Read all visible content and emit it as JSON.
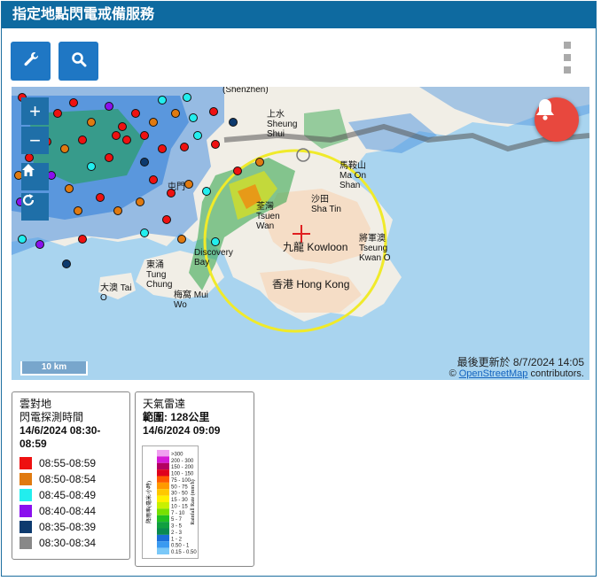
{
  "title": "指定地點閃電戒備服務",
  "toolbar": {
    "tools_icon": "wrench-icon",
    "search_icon": "search-icon",
    "menu_icon": "kebab-menu-icon"
  },
  "map": {
    "zoom_in": "+",
    "zoom_out": "−",
    "scale_label": "10 km",
    "updated": "最後更新於 8/7/2024 14:05",
    "attribution_prefix": "© ",
    "attribution_link": "OpenStreetMap",
    "attribution_suffix": " contributors.",
    "labels": {
      "kowloon": "九龍 Kowloon",
      "hongkong": "香港 Hong Kong",
      "shatin": "沙田 Sha Tin",
      "tsuenwan": "荃灣 Tsuen Wan",
      "tseungkwano": "將軍澳 Tseung Kwan O",
      "maon": "馬鞍山 Ma On Shan",
      "tungchung": "東涌 Tung Chung",
      "taio": "大澳 Tai O",
      "muiwo": "梅窩 Mui Wo",
      "discovery": "Discovery Bay",
      "sheungshui": "上水 Sheung Shui",
      "tuenmun": "屯門",
      "shenzhen": "(Shenzhen)"
    },
    "colors": {
      "sea": "#a9d4ef",
      "land": "#f1eee6",
      "circle": "#f0ea2a",
      "marker": "#e02020",
      "bell": "#e8483e"
    }
  },
  "lightning_legend": {
    "title1": "雲對地",
    "title2": "閃電探測時間",
    "date_range": "14/6/2024 08:30-08:59",
    "items": [
      {
        "label": "08:55-08:59",
        "color": "#ee1111"
      },
      {
        "label": "08:50-08:54",
        "color": "#e07a10"
      },
      {
        "label": "08:45-08:49",
        "color": "#22eeee"
      },
      {
        "label": "08:40-08:44",
        "color": "#8a10ee"
      },
      {
        "label": "08:35-08:39",
        "color": "#0d3a6e"
      },
      {
        "label": "08:30-08:34",
        "color": "#888888"
      }
    ]
  },
  "radar_legend": {
    "title": "天氣雷達",
    "range": "範圍: 128公里",
    "datetime": "14/6/2024 09:09",
    "side_left": "降雨率(毫米/小時)",
    "side_right": "Rainfall Rate (mm/h)",
    "levels": [
      {
        "label": ">300",
        "color": "#f0a0f0"
      },
      {
        "label": "200 - 300",
        "color": "#d61ad6"
      },
      {
        "label": "150 - 200",
        "color": "#b40060"
      },
      {
        "label": "100 - 150",
        "color": "#e0001e"
      },
      {
        "label": "75 - 100",
        "color": "#ff5a00"
      },
      {
        "label": "50 - 75",
        "color": "#ff9a00"
      },
      {
        "label": "30 - 50",
        "color": "#ffc800"
      },
      {
        "label": "15 - 30",
        "color": "#fff000"
      },
      {
        "label": "10 - 15",
        "color": "#c8f000"
      },
      {
        "label": "7 - 10",
        "color": "#78e000"
      },
      {
        "label": "5 - 7",
        "color": "#20c020"
      },
      {
        "label": "3 - 5",
        "color": "#10a040"
      },
      {
        "label": "2 - 3",
        "color": "#0a8a50"
      },
      {
        "label": "1 - 2",
        "color": "#1a6ed8"
      },
      {
        "label": "0.50 - 1",
        "color": "#3a9af0"
      },
      {
        "label": "0.15 - 0.50",
        "color": "#7ac8f8"
      }
    ]
  }
}
